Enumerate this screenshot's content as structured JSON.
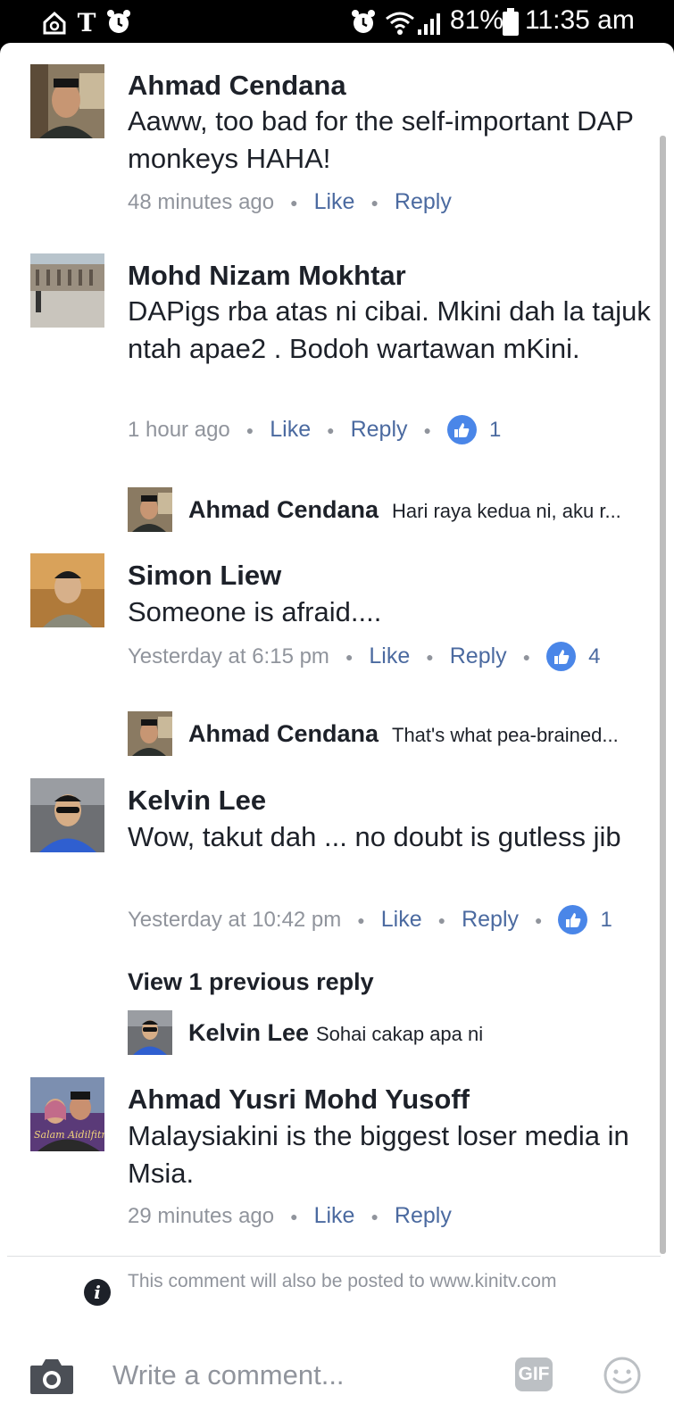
{
  "status_bar": {
    "battery": "81%",
    "time": "11:35 am",
    "icons": [
      "home-sync-icon",
      "nytimes-icon",
      "alarm-icon",
      "alarm-icon",
      "wifi-icon",
      "signal-icon",
      "battery-icon"
    ]
  },
  "comments": [
    {
      "name": "Ahmad Cendana",
      "text": "Aaww, too bad for the self-important DAP monkeys HAHA!",
      "time": "48 minutes ago",
      "like": "Like",
      "reply": "Reply"
    },
    {
      "name": "Mohd Nizam Mokhtar",
      "text": "DAPigs rba atas ni cibai. Mkini dah la tajuk ntah apae2 . Bodoh wartawan mKini.",
      "time": "1 hour ago",
      "like": "Like",
      "reply": "Reply",
      "likes": "1",
      "reply_preview": {
        "name": "Ahmad Cendana",
        "text": "Hari raya kedua ni, aku r..."
      }
    },
    {
      "name": "Simon Liew",
      "text": "Someone is afraid....",
      "time": "Yesterday at 6:15 pm",
      "like": "Like",
      "reply": "Reply",
      "likes": "4",
      "reply_preview": {
        "name": "Ahmad Cendana",
        "text": "That's what pea-brained..."
      }
    },
    {
      "name": "Kelvin Lee",
      "text": "Wow, takut dah ... no doubt is gutless jib",
      "time": "Yesterday at 10:42 pm",
      "like": "Like",
      "reply": "Reply",
      "likes": "1",
      "view_previous": "View 1 previous reply",
      "reply_preview": {
        "name": "Kelvin Lee",
        "text": "Sohai cakap apa ni"
      }
    },
    {
      "name": "Ahmad Yusri Mohd Yusoff",
      "text": "Malaysiakini is the biggest loser media in Msia.",
      "time": "29 minutes ago",
      "like": "Like",
      "reply": "Reply",
      "avatar_overlay_text": "Salam Aidilfitri"
    }
  ],
  "notice": "This comment will also be posted to www.kinitv.com",
  "composer": {
    "placeholder": "Write a comment...",
    "gif_label": "GIF"
  },
  "colors": {
    "link": "#4b6aa0",
    "meta": "#90949c",
    "text": "#1d2129",
    "like_badge": "#4a86e8"
  }
}
